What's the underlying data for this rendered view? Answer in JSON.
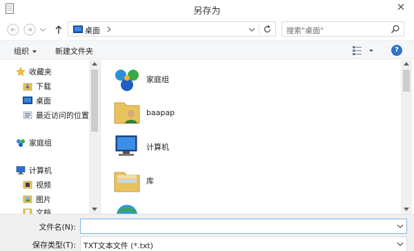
{
  "window": {
    "title": "另存为"
  },
  "address": {
    "location": "桌面"
  },
  "search": {
    "placeholder": "搜索\"桌面\""
  },
  "toolbar": {
    "organize_label": "组织",
    "new_folder_label": "新建文件夹"
  },
  "sidebar": {
    "items": [
      {
        "label": "收藏夹",
        "icon": "star-icon"
      },
      {
        "label": "下载",
        "icon": "download-folder-icon"
      },
      {
        "label": "桌面",
        "icon": "desktop-icon"
      },
      {
        "label": "最近访问的位置",
        "icon": "recent-places-icon"
      },
      {
        "label": "家庭组",
        "icon": "homegroup-icon"
      },
      {
        "label": "计算机",
        "icon": "computer-icon"
      },
      {
        "label": "视频",
        "icon": "videos-icon"
      },
      {
        "label": "图片",
        "icon": "pictures-icon"
      },
      {
        "label": "文档",
        "icon": "documents-icon"
      }
    ]
  },
  "content": {
    "items": [
      {
        "label": "家庭组",
        "icon": "homegroup-icon"
      },
      {
        "label": "baapap",
        "icon": "user-folder-icon"
      },
      {
        "label": "计算机",
        "icon": "computer-icon"
      },
      {
        "label": "库",
        "icon": "libraries-icon"
      },
      {
        "label": "",
        "icon": "network-icon"
      }
    ]
  },
  "fields": {
    "filename_label": "文件名(N):",
    "filename_value": "",
    "filetype_label": "保存类型(T):",
    "filetype_value": "TXT文本文件 (*.txt)"
  },
  "colors": {
    "accent": "#2f74c9",
    "input_focus": "#7eb4ea"
  }
}
